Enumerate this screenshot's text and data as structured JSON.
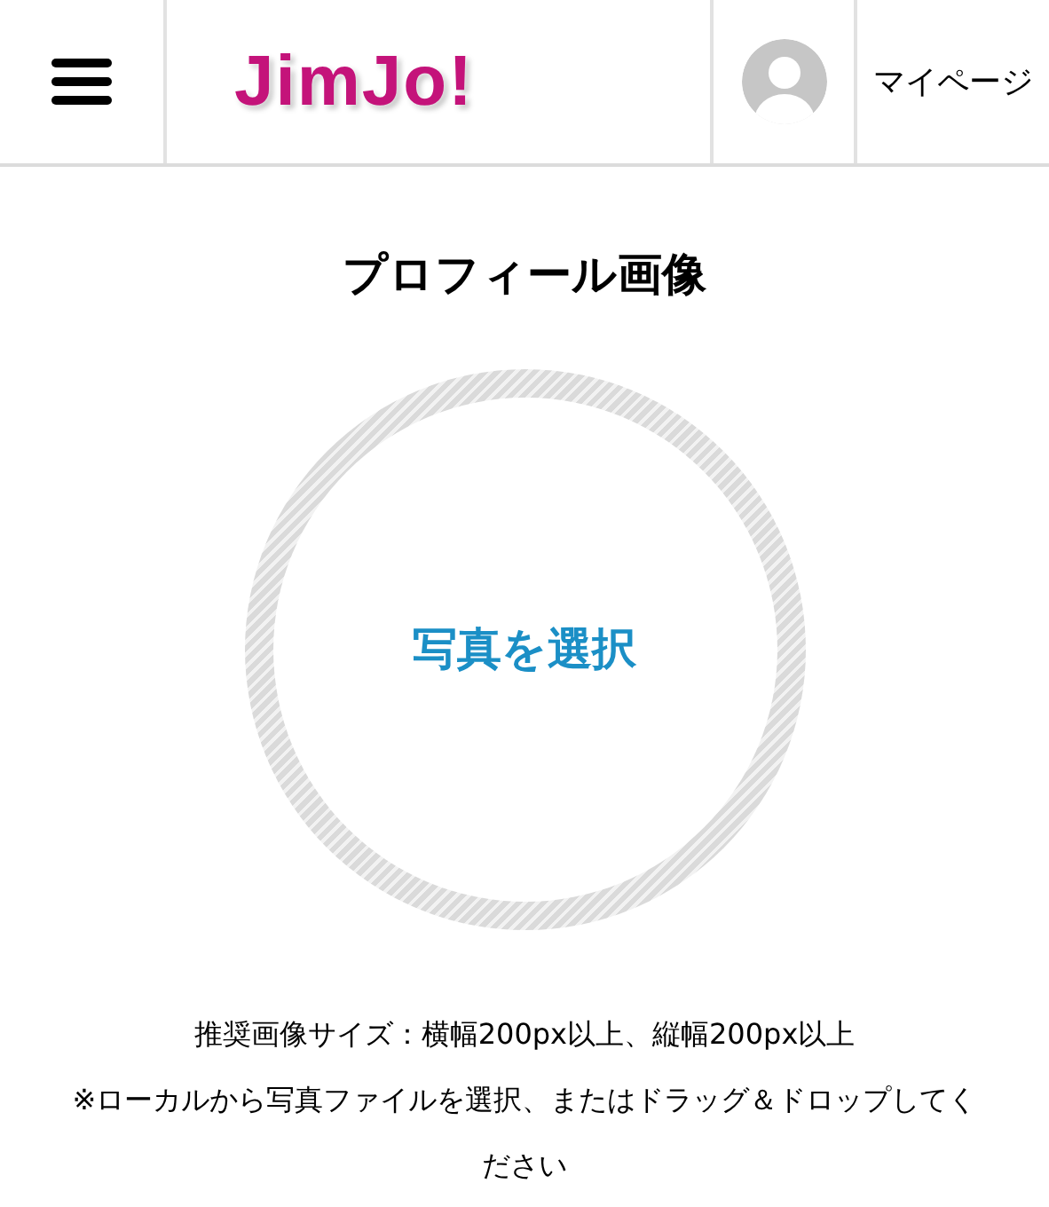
{
  "header": {
    "logo": "JimJo!",
    "mypage_link": "マイページ"
  },
  "title": "プロフィール画像",
  "photo_button": "写真を選択",
  "notes": [
    "推奨画像サイズ：横幅200px以上、縦幅200px以上",
    "※ローカルから写真ファイルを選択、またはドラッグ＆ドロップしてください"
  ]
}
